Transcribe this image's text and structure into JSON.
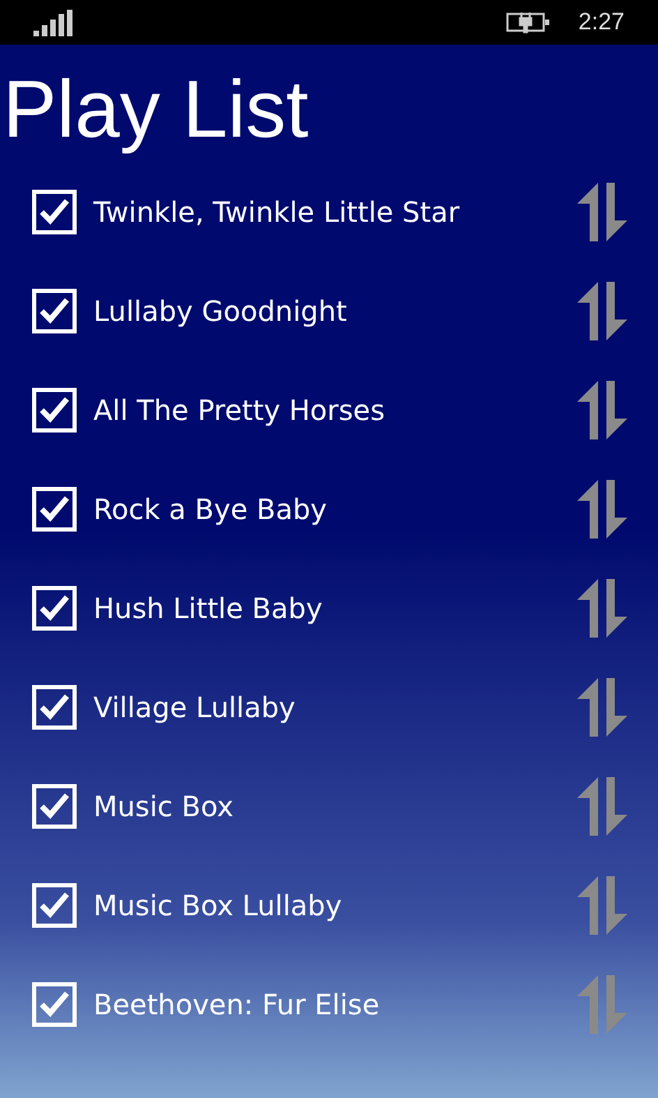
{
  "status_bar": {
    "time": "2:27"
  },
  "title": "Play List",
  "songs": [
    {
      "name": "Twinkle, Twinkle Little Star",
      "checked": true
    },
    {
      "name": "Lullaby Goodnight",
      "checked": true
    },
    {
      "name": "All The Pretty Horses",
      "checked": true
    },
    {
      "name": "Rock a Bye Baby",
      "checked": true
    },
    {
      "name": "Hush Little Baby",
      "checked": true
    },
    {
      "name": "Village Lullaby",
      "checked": true
    },
    {
      "name": "Music Box",
      "checked": true
    },
    {
      "name": "Music Box Lullaby",
      "checked": true
    },
    {
      "name": "Beethoven: Fur Elise",
      "checked": true
    }
  ]
}
